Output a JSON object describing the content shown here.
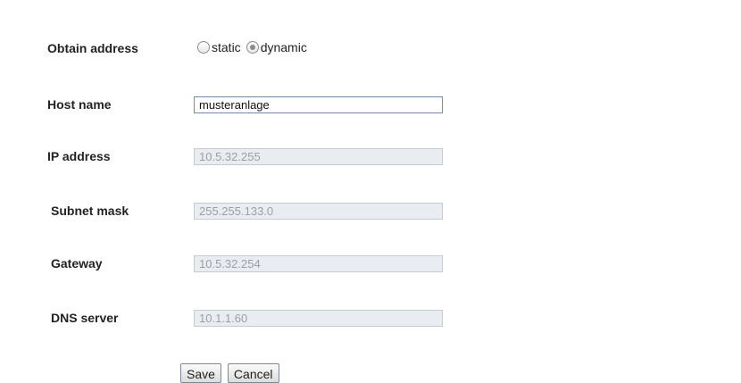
{
  "form": {
    "obtain_address": {
      "label": "Obtain address",
      "options": [
        {
          "label": "static",
          "checked": false
        },
        {
          "label": "dynamic",
          "checked": true
        }
      ]
    },
    "host_name": {
      "label": "Host name",
      "value": "musteranlage",
      "enabled": true
    },
    "ip_address": {
      "label": "IP address",
      "value": "10.5.32.255",
      "enabled": false
    },
    "subnet_mask": {
      "label": "Subnet mask",
      "value": "255.255.133.0",
      "enabled": false
    },
    "gateway": {
      "label": "Gateway",
      "value": "10.5.32.254",
      "enabled": false
    },
    "dns_server": {
      "label": "DNS server",
      "value": "10.1.1.60",
      "enabled": false
    }
  },
  "buttons": {
    "save_label": "Save",
    "cancel_label": "Cancel"
  }
}
